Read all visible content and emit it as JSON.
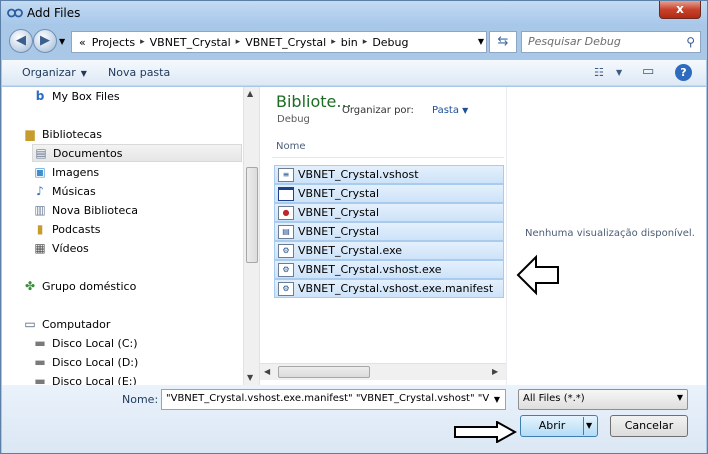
{
  "window": {
    "title": "Add Files",
    "close_label": "x"
  },
  "address": {
    "prefix": "«",
    "segments": [
      "Projects",
      "VBNET_Crystal",
      "VBNET_Crystal",
      "bin",
      "Debug"
    ],
    "separator": "▸"
  },
  "search": {
    "placeholder": "Pesquisar Debug"
  },
  "toolbar": {
    "organize": "Organizar",
    "new_folder": "Nova pasta"
  },
  "nav": {
    "items": [
      {
        "label": "My Box Files",
        "icon": "box-icon"
      },
      {
        "label": "Bibliotecas",
        "icon": "libraries-icon"
      },
      {
        "label": "Documentos",
        "icon": "documents-icon",
        "selected": true
      },
      {
        "label": "Imagens",
        "icon": "pictures-icon"
      },
      {
        "label": "Músicas",
        "icon": "music-icon"
      },
      {
        "label": "Nova Biblioteca",
        "icon": "library-icon"
      },
      {
        "label": "Podcasts",
        "icon": "podcasts-icon"
      },
      {
        "label": "Vídeos",
        "icon": "videos-icon"
      },
      {
        "label": "Grupo doméstico",
        "icon": "homegroup-icon"
      },
      {
        "label": "Computador",
        "icon": "computer-icon"
      },
      {
        "label": "Disco Local (C:)",
        "icon": "drive-icon"
      },
      {
        "label": "Disco Local (D:)",
        "icon": "drive-icon"
      },
      {
        "label": "Disco Local (E:)",
        "icon": "drive-icon"
      }
    ]
  },
  "library": {
    "title": "Bibliote...",
    "subtitle": "Debug",
    "arrange_by_label": "Organizar por:",
    "arrange_by_value": "Pasta",
    "column_name": "Nome"
  },
  "files": [
    {
      "name": "VBNET_Crystal.vshost",
      "icon": "config-file-icon"
    },
    {
      "name": "VBNET_Crystal",
      "icon": "window-file-icon"
    },
    {
      "name": "VBNET_Crystal",
      "icon": "crystal-report-icon"
    },
    {
      "name": "VBNET_Crystal",
      "icon": "document-file-icon"
    },
    {
      "name": "VBNET_Crystal.exe",
      "icon": "exe-file-icon"
    },
    {
      "name": "VBNET_Crystal.vshost.exe",
      "icon": "exe-file-icon"
    },
    {
      "name": "VBNET_Crystal.vshost.exe.manifest",
      "icon": "manifest-file-icon"
    }
  ],
  "preview": {
    "message": "Nenhuma visualização disponível."
  },
  "footer": {
    "name_label": "Nome:",
    "name_value": "\"VBNET_Crystal.vshost.exe.manifest\" \"VBNET_Crystal.vshost\" \"VBNET",
    "filter_value": "All Files (*.*)",
    "open_label": "Abrir",
    "cancel_label": "Cancelar"
  }
}
